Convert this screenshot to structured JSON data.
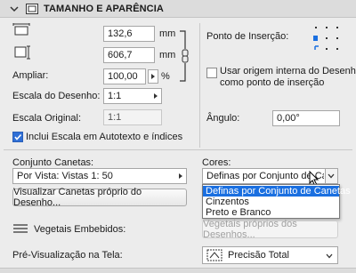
{
  "header": {
    "title": "TAMANHO E APARÊNCIA",
    "chevron_icon": "chevron-down-icon",
    "section_icon": "size-appearance-icon"
  },
  "width": {
    "value": "132,6",
    "unit": "mm"
  },
  "height": {
    "value": "606,7",
    "unit": "mm"
  },
  "enlarge": {
    "label": "Ampliar:",
    "value": "100,00",
    "unit": "%"
  },
  "drawing_scale": {
    "label": "Escala do Desenho:",
    "value": "1:1"
  },
  "original_scale": {
    "label": "Escala Original:",
    "value": "1:1"
  },
  "anchor": {
    "label": "Ponto de Inserção:"
  },
  "use_origin": {
    "label_line1": "Usar origem interna do Desenho",
    "label_line2": "como ponto de inserção",
    "checked": false
  },
  "angle": {
    "label": "Ângulo:",
    "value": "0,00°"
  },
  "include_scale": {
    "label": "Inclui Escala em Autotexto e índices",
    "checked": true
  },
  "pen_set": {
    "label": "Conjunto Canetas:",
    "value": "Por Vista: Vistas 1: 50"
  },
  "view_pens_button": "Visualizar Canetas próprio do Desenho...",
  "colors": {
    "label": "Cores:",
    "value": "Definas por Conjunto de Canetas",
    "options": [
      "Definas por Conjunto de Canetas",
      "Cinzentos",
      "Preto e Branco"
    ],
    "selected_index": 0
  },
  "embedded_fills": {
    "label": "Vegetais Embebidos:",
    "button": "Vegetais próprios dos Desenhos..."
  },
  "preview": {
    "label": "Pré-Visualização na Tela:",
    "value": "Precisão Total"
  },
  "colors_theme": {
    "accent": "#1a6fe0",
    "checkbox_on": "#2f6fd6"
  }
}
